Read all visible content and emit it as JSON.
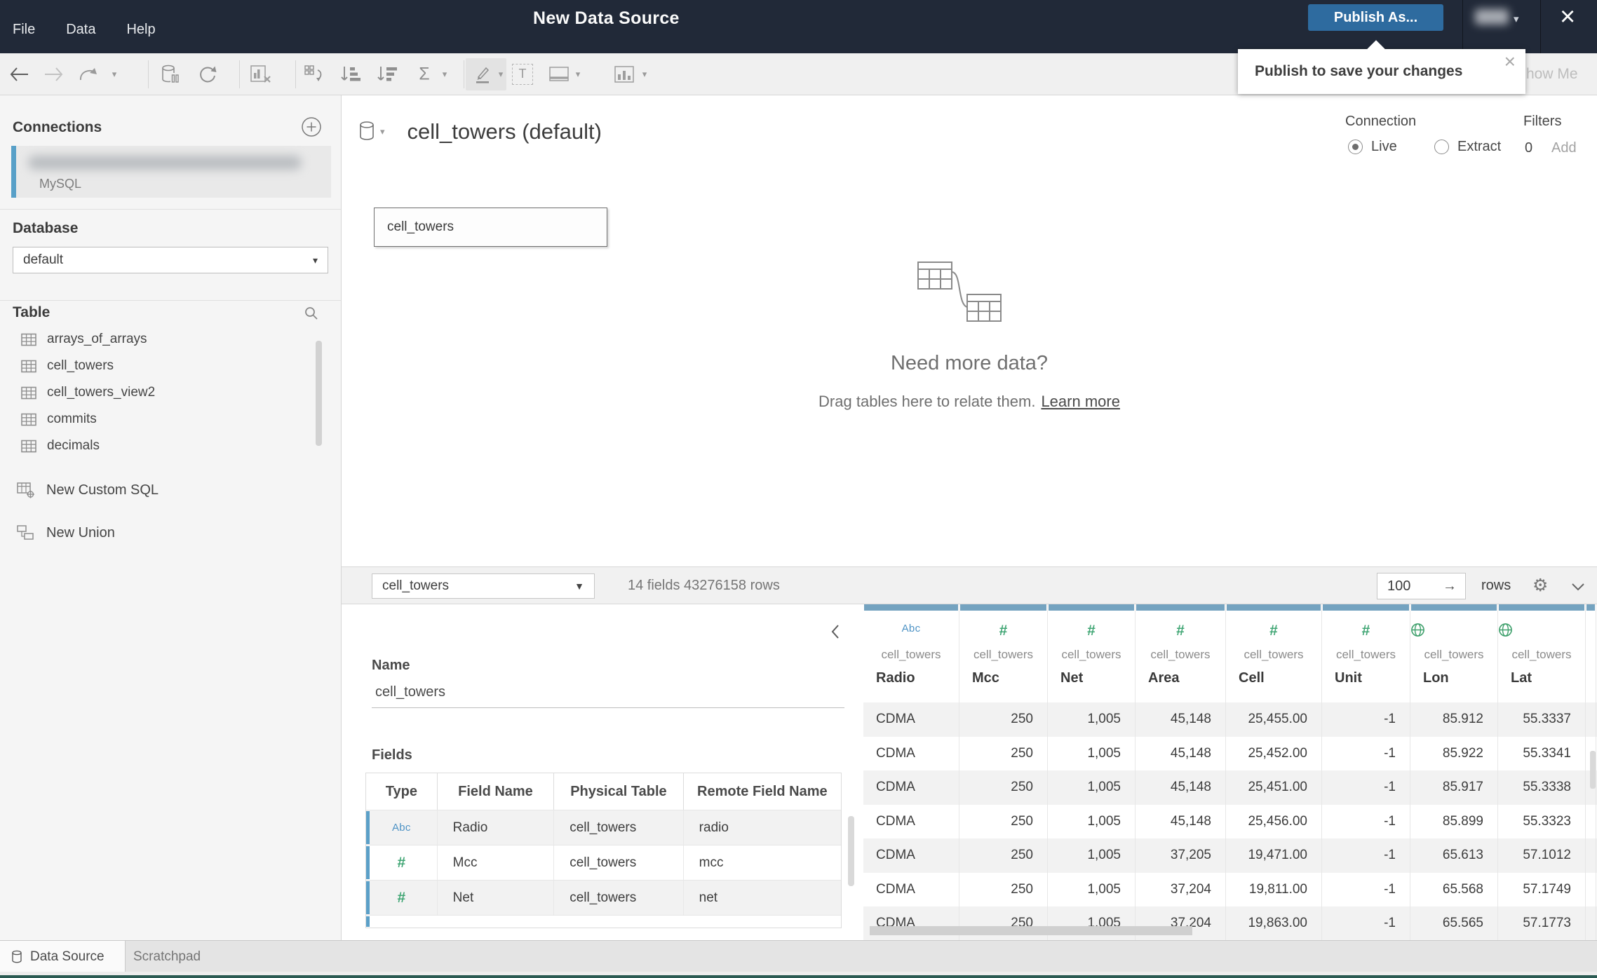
{
  "app": {
    "menus": [
      "File",
      "Data",
      "Help"
    ],
    "title": "New Data Source",
    "publish_button": "Publish As...",
    "tooltip_text": "Publish to save your changes",
    "show_me": "Show Me"
  },
  "sidebar": {
    "connections_label": "Connections",
    "connection_type": "MySQL",
    "database_label": "Database",
    "database_value": "default",
    "table_label": "Table",
    "tables": [
      "arrays_of_arrays",
      "cell_towers",
      "cell_towers_view2",
      "commits",
      "decimals"
    ],
    "new_custom_sql": "New Custom SQL",
    "new_union": "New Union"
  },
  "canvas": {
    "datasource_title": "cell_towers (default)",
    "table_box_label": "cell_towers",
    "connection_label": "Connection",
    "live_label": "Live",
    "extract_label": "Extract",
    "filters_label": "Filters",
    "filters_count": "0",
    "filters_add": "Add",
    "empty_heading": "Need more data?",
    "empty_body": "Drag tables here to relate them.",
    "empty_link": "Learn more"
  },
  "preview": {
    "table_select": "cell_towers",
    "summary": "14 fields 43276158 rows",
    "row_count": "100",
    "rows_label": "rows"
  },
  "metadata": {
    "name_label": "Name",
    "name_value": "cell_towers",
    "fields_label": "Fields",
    "columns": [
      "Type",
      "Field Name",
      "Physical Table",
      "Remote Field Name"
    ],
    "rows": [
      {
        "type": "string",
        "field": "Radio",
        "table": "cell_towers",
        "remote": "radio"
      },
      {
        "type": "number",
        "field": "Mcc",
        "table": "cell_towers",
        "remote": "mcc"
      },
      {
        "type": "number",
        "field": "Net",
        "table": "cell_towers",
        "remote": "net"
      }
    ]
  },
  "grid": {
    "columns": [
      {
        "type": "string",
        "table": "cell_towers",
        "name": "Radio"
      },
      {
        "type": "number",
        "table": "cell_towers",
        "name": "Mcc"
      },
      {
        "type": "number",
        "table": "cell_towers",
        "name": "Net"
      },
      {
        "type": "number",
        "table": "cell_towers",
        "name": "Area"
      },
      {
        "type": "number",
        "table": "cell_towers",
        "name": "Cell"
      },
      {
        "type": "number",
        "table": "cell_towers",
        "name": "Unit"
      },
      {
        "type": "geo",
        "table": "cell_towers",
        "name": "Lon"
      },
      {
        "type": "geo",
        "table": "cell_towers",
        "name": "Lat"
      }
    ],
    "rows": [
      [
        "CDMA",
        "250",
        "1,005",
        "45,148",
        "25,455.00",
        "-1",
        "85.912",
        "55.3337"
      ],
      [
        "CDMA",
        "250",
        "1,005",
        "45,148",
        "25,452.00",
        "-1",
        "85.922",
        "55.3341"
      ],
      [
        "CDMA",
        "250",
        "1,005",
        "45,148",
        "25,451.00",
        "-1",
        "85.917",
        "55.3338"
      ],
      [
        "CDMA",
        "250",
        "1,005",
        "45,148",
        "25,456.00",
        "-1",
        "85.899",
        "55.3323"
      ],
      [
        "CDMA",
        "250",
        "1,005",
        "37,205",
        "19,471.00",
        "-1",
        "65.613",
        "57.1012"
      ],
      [
        "CDMA",
        "250",
        "1,005",
        "37,204",
        "19,811.00",
        "-1",
        "65.568",
        "57.1749"
      ],
      [
        "CDMA",
        "250",
        "1,005",
        "37,204",
        "19,863.00",
        "-1",
        "65.565",
        "57.1773"
      ]
    ]
  },
  "tabs": {
    "data_source": "Data Source",
    "scratchpad": "Scratchpad"
  },
  "colors": {
    "topbar": "#212938",
    "accent_blue": "#2e6b9f",
    "steel_blue": "#74a3c0",
    "type_green": "#3fa573",
    "type_blue": "#4e93c5",
    "bottom_teal": "#2a5a52"
  }
}
